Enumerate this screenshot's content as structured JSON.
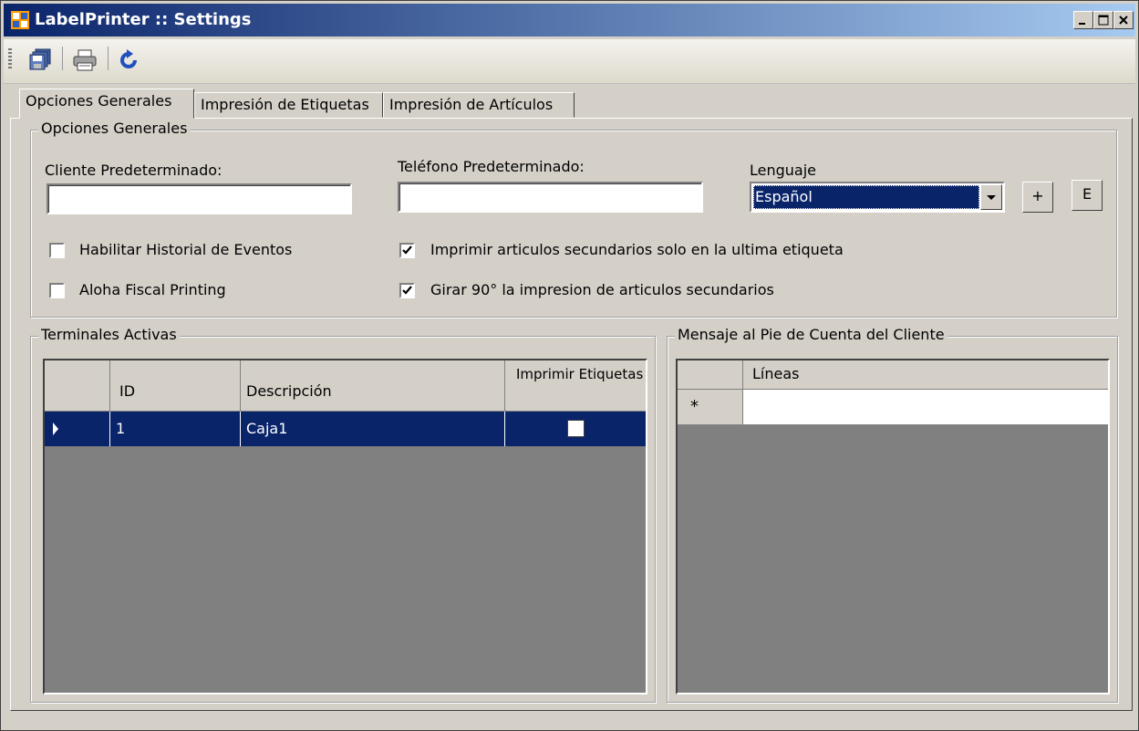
{
  "window": {
    "title": "LabelPrinter :: Settings"
  },
  "toolbar": {
    "items": [
      {
        "icon": "save-icon"
      },
      {
        "icon": "print-icon"
      },
      {
        "icon": "refresh-icon"
      }
    ]
  },
  "tabs": [
    {
      "label": "Opciones Generales",
      "active": true
    },
    {
      "label": "Impresión de Etiquetas",
      "active": false
    },
    {
      "label": "Impresión de Artículos",
      "active": false
    }
  ],
  "general": {
    "group_title": "Opciones Generales",
    "default_client_label": "Cliente Predeterminado:",
    "default_client_value": "",
    "default_phone_label": "Teléfono Predeterminado:",
    "default_phone_value": "",
    "language_label": "Lenguaje",
    "language_value": "Español",
    "add_button": "+",
    "edit_button": "E",
    "checkboxes": [
      {
        "label": "Habilitar Historial de Eventos",
        "checked": false
      },
      {
        "label": "Aloha Fiscal Printing",
        "checked": false
      },
      {
        "label": "Imprimir articulos secundarios solo en la ultima etiqueta",
        "checked": true
      },
      {
        "label": "Girar 90° la impresion de articulos secundarios",
        "checked": true
      }
    ]
  },
  "terminals": {
    "group_title": "Terminales Activas",
    "columns": [
      "ID",
      "Descripción",
      "Imprimir Etiquetas"
    ],
    "rows": [
      {
        "id": "1",
        "descripcion": "Caja1",
        "imprimir": false
      }
    ]
  },
  "footer_message": {
    "group_title": "Mensaje al Pie de Cuenta del Cliente",
    "columns": [
      "Líneas"
    ],
    "new_row_marker": "*"
  },
  "colors": {
    "titlebar_start": "#0a246a",
    "selection": "#0a246a",
    "face": "#d4d0c8",
    "grid_bg": "#808080"
  }
}
